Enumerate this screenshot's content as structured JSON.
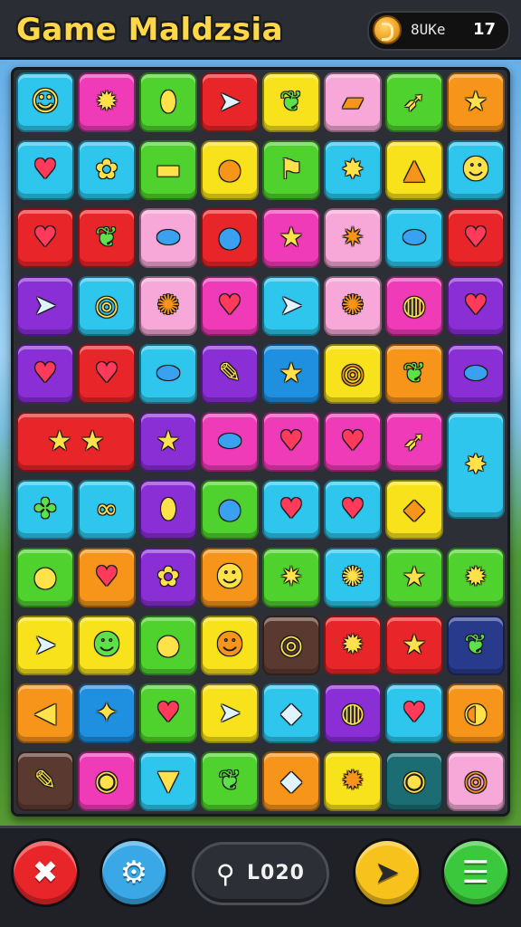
{
  "header": {
    "title": "Game Maldzsia",
    "currency_label": "8UKe",
    "currency_count": "17"
  },
  "colors": {
    "cyan": "#2fc6ee",
    "magenta": "#f03bb8",
    "green": "#4fd12e",
    "red": "#e8262a",
    "yellow": "#f7e21c",
    "pink": "#f7a8d8",
    "orange": "#f7941a",
    "purple": "#8a2fd6",
    "blue": "#1f8fe0",
    "darkblue": "#283a8c",
    "brown": "#5a3a30",
    "teal": "#1c6c74"
  },
  "board": {
    "rows": [
      [
        {
          "color": "cyan",
          "icon": "drop-face-icon",
          "glyph": "☺"
        },
        {
          "color": "magenta",
          "icon": "sun-icon",
          "glyph": "✹"
        },
        {
          "color": "green",
          "icon": "acorn-icon",
          "glyph": "⬮"
        },
        {
          "color": "red",
          "icon": "paper-plane-icon",
          "glyph": "➤"
        },
        {
          "color": "yellow",
          "icon": "leaf-icon",
          "glyph": "❦"
        },
        {
          "color": "pink",
          "icon": "cake-icon",
          "glyph": "▰"
        },
        {
          "color": "green",
          "icon": "bird-icon",
          "glyph": "➶"
        },
        {
          "color": "orange",
          "icon": "star-icon",
          "glyph": "★"
        }
      ],
      [
        {
          "color": "cyan",
          "icon": "heart-icon",
          "glyph": "♥"
        },
        {
          "color": "cyan",
          "icon": "flower-icon",
          "glyph": "✿"
        },
        {
          "color": "green",
          "icon": "flag-icon",
          "glyph": "▬"
        },
        {
          "color": "yellow",
          "icon": "apple-icon",
          "glyph": "●"
        },
        {
          "color": "green",
          "icon": "signpost-icon",
          "glyph": "⚑"
        },
        {
          "color": "cyan",
          "icon": "spiky-ball-icon",
          "glyph": "✸"
        },
        {
          "color": "yellow",
          "icon": "pyramid-icon",
          "glyph": "▲"
        },
        {
          "color": "cyan",
          "icon": "chat-face-icon",
          "glyph": "☻"
        }
      ],
      [
        {
          "color": "red",
          "icon": "heart-icon",
          "glyph": "♥"
        },
        {
          "color": "red",
          "icon": "leaf-icon",
          "glyph": "❦"
        },
        {
          "color": "pink",
          "icon": "bean-icon",
          "glyph": "⬬"
        },
        {
          "color": "red",
          "icon": "bomb-icon",
          "glyph": "●"
        },
        {
          "color": "magenta",
          "icon": "star-icon",
          "glyph": "★"
        },
        {
          "color": "pink",
          "icon": "burst-star-icon",
          "glyph": "✷"
        },
        {
          "color": "cyan",
          "icon": "bean-icon",
          "glyph": "⬬"
        },
        {
          "color": "red",
          "icon": "heart-icon",
          "glyph": "♥"
        }
      ],
      [
        {
          "color": "purple",
          "icon": "paper-plane-icon",
          "glyph": "➤"
        },
        {
          "color": "cyan",
          "icon": "swirl-icon",
          "glyph": "◎"
        },
        {
          "color": "pink",
          "icon": "gear-icon",
          "glyph": "✺"
        },
        {
          "color": "magenta",
          "icon": "heart-icon",
          "glyph": "♥"
        },
        {
          "color": "cyan",
          "icon": "paper-plane-icon",
          "glyph": "➤"
        },
        {
          "color": "pink",
          "icon": "gear-icon",
          "glyph": "✺"
        },
        {
          "color": "magenta",
          "icon": "spiral-icon",
          "glyph": "◍"
        },
        {
          "color": "purple",
          "icon": "heart-icon",
          "glyph": "♥"
        }
      ],
      [
        {
          "color": "purple",
          "icon": "heart-icon",
          "glyph": "♥"
        },
        {
          "color": "red",
          "icon": "bubble-heart-icon",
          "glyph": "♥"
        },
        {
          "color": "cyan",
          "icon": "bean-icon",
          "glyph": "⬬"
        },
        {
          "color": "purple",
          "icon": "quill-icon",
          "glyph": "✎"
        },
        {
          "color": "blue",
          "icon": "star-icon",
          "glyph": "★"
        },
        {
          "color": "yellow",
          "icon": "spiral-icon",
          "glyph": "◎"
        },
        {
          "color": "orange",
          "icon": "leaf-icon",
          "glyph": "❦"
        },
        {
          "color": "purple",
          "icon": "bean-icon",
          "glyph": "⬬"
        }
      ],
      [
        {
          "color": "red",
          "icon": "double-star-icon",
          "glyph": "★   ★",
          "wide": true
        },
        {
          "color": "purple",
          "icon": "star-icon",
          "glyph": "★"
        },
        {
          "color": "magenta",
          "icon": "bean-icon",
          "glyph": "⬬"
        },
        {
          "color": "magenta",
          "icon": "heart-icon",
          "glyph": "♥"
        },
        {
          "color": "magenta",
          "icon": "heart-icon",
          "glyph": "♥"
        },
        {
          "color": "magenta",
          "icon": "bird-icon",
          "glyph": "➶"
        },
        {
          "color": "cyan",
          "icon": "spiky-ball-icon",
          "glyph": "✸",
          "tall": true
        }
      ],
      [
        {
          "color": "cyan",
          "icon": "clover-icon",
          "glyph": "✤"
        },
        {
          "color": "cyan",
          "icon": "mask-icon",
          "glyph": "∞"
        },
        {
          "color": "purple",
          "icon": "candy-icon",
          "glyph": "⬮"
        },
        {
          "color": "green",
          "icon": "balloon-icon",
          "glyph": "●"
        },
        {
          "color": "cyan",
          "icon": "heart-icon",
          "glyph": "♥"
        },
        {
          "color": "cyan",
          "icon": "heart-icon",
          "glyph": "♥"
        },
        {
          "color": "yellow",
          "icon": "gem-icon",
          "glyph": "◆"
        }
      ],
      [
        {
          "color": "green",
          "icon": "seed-icon",
          "glyph": "●"
        },
        {
          "color": "orange",
          "icon": "heart-icon",
          "glyph": "♥"
        },
        {
          "color": "purple",
          "icon": "blob-icon",
          "glyph": "✿"
        },
        {
          "color": "orange",
          "icon": "slime-face-icon",
          "glyph": "☻"
        },
        {
          "color": "green",
          "icon": "spiky-star-icon",
          "glyph": "✷"
        },
        {
          "color": "cyan",
          "icon": "gear-icon",
          "glyph": "✺"
        },
        {
          "color": "green",
          "icon": "star-icon",
          "glyph": "★"
        },
        {
          "color": "green",
          "icon": "sun-icon",
          "glyph": "✹"
        }
      ],
      [
        {
          "color": "yellow",
          "icon": "paper-plane-icon",
          "glyph": "➤"
        },
        {
          "color": "yellow",
          "icon": "frog-icon",
          "glyph": "☻"
        },
        {
          "color": "green",
          "icon": "blob-icon",
          "glyph": "●"
        },
        {
          "color": "yellow",
          "icon": "cheese-icon",
          "glyph": "☻"
        },
        {
          "color": "brown",
          "icon": "swirl-icon",
          "glyph": "◎"
        },
        {
          "color": "red",
          "icon": "sun-icon",
          "glyph": "✹"
        },
        {
          "color": "red",
          "icon": "star-icon",
          "glyph": "★"
        },
        {
          "color": "darkblue",
          "icon": "leaf-icon",
          "glyph": "❦"
        }
      ],
      [
        {
          "color": "orange",
          "icon": "horn-icon",
          "glyph": "◀"
        },
        {
          "color": "blue",
          "icon": "sparkle-icon",
          "glyph": "✦"
        },
        {
          "color": "green",
          "icon": "lightning-heart-icon",
          "glyph": "♥"
        },
        {
          "color": "yellow",
          "icon": "paper-plane-icon",
          "glyph": "➤"
        },
        {
          "color": "cyan",
          "icon": "kite-icon",
          "glyph": "◆"
        },
        {
          "color": "purple",
          "icon": "spiral-icon",
          "glyph": "◍"
        },
        {
          "color": "cyan",
          "icon": "heart-icon",
          "glyph": "♥"
        },
        {
          "color": "orange",
          "icon": "shell-icon",
          "glyph": "◑"
        }
      ],
      [
        {
          "color": "brown",
          "icon": "pen-icon",
          "glyph": "✎"
        },
        {
          "color": "magenta",
          "icon": "donut-icon",
          "glyph": "◉"
        },
        {
          "color": "cyan",
          "icon": "cup-icon",
          "glyph": "▼"
        },
        {
          "color": "green",
          "icon": "leaf-icon",
          "glyph": "❦"
        },
        {
          "color": "orange",
          "icon": "kite-icon",
          "glyph": "◆"
        },
        {
          "color": "yellow",
          "icon": "sun-icon",
          "glyph": "✹"
        },
        {
          "color": "teal",
          "icon": "bubble-icon",
          "glyph": "◉"
        },
        {
          "color": "pink",
          "icon": "swirl-icon",
          "glyph": "◎"
        }
      ]
    ]
  },
  "footer": {
    "shuffle_glyph": "✖",
    "settings_glyph": "⚙",
    "location_glyph": "⚲",
    "score_value": "L020",
    "send_glyph": "➤",
    "menu_glyph": "☰",
    "shuffle_color": "#e8262a",
    "settings_color": "#3aa8e6",
    "send_color": "#f7c21c",
    "menu_color": "#3cc83c"
  }
}
